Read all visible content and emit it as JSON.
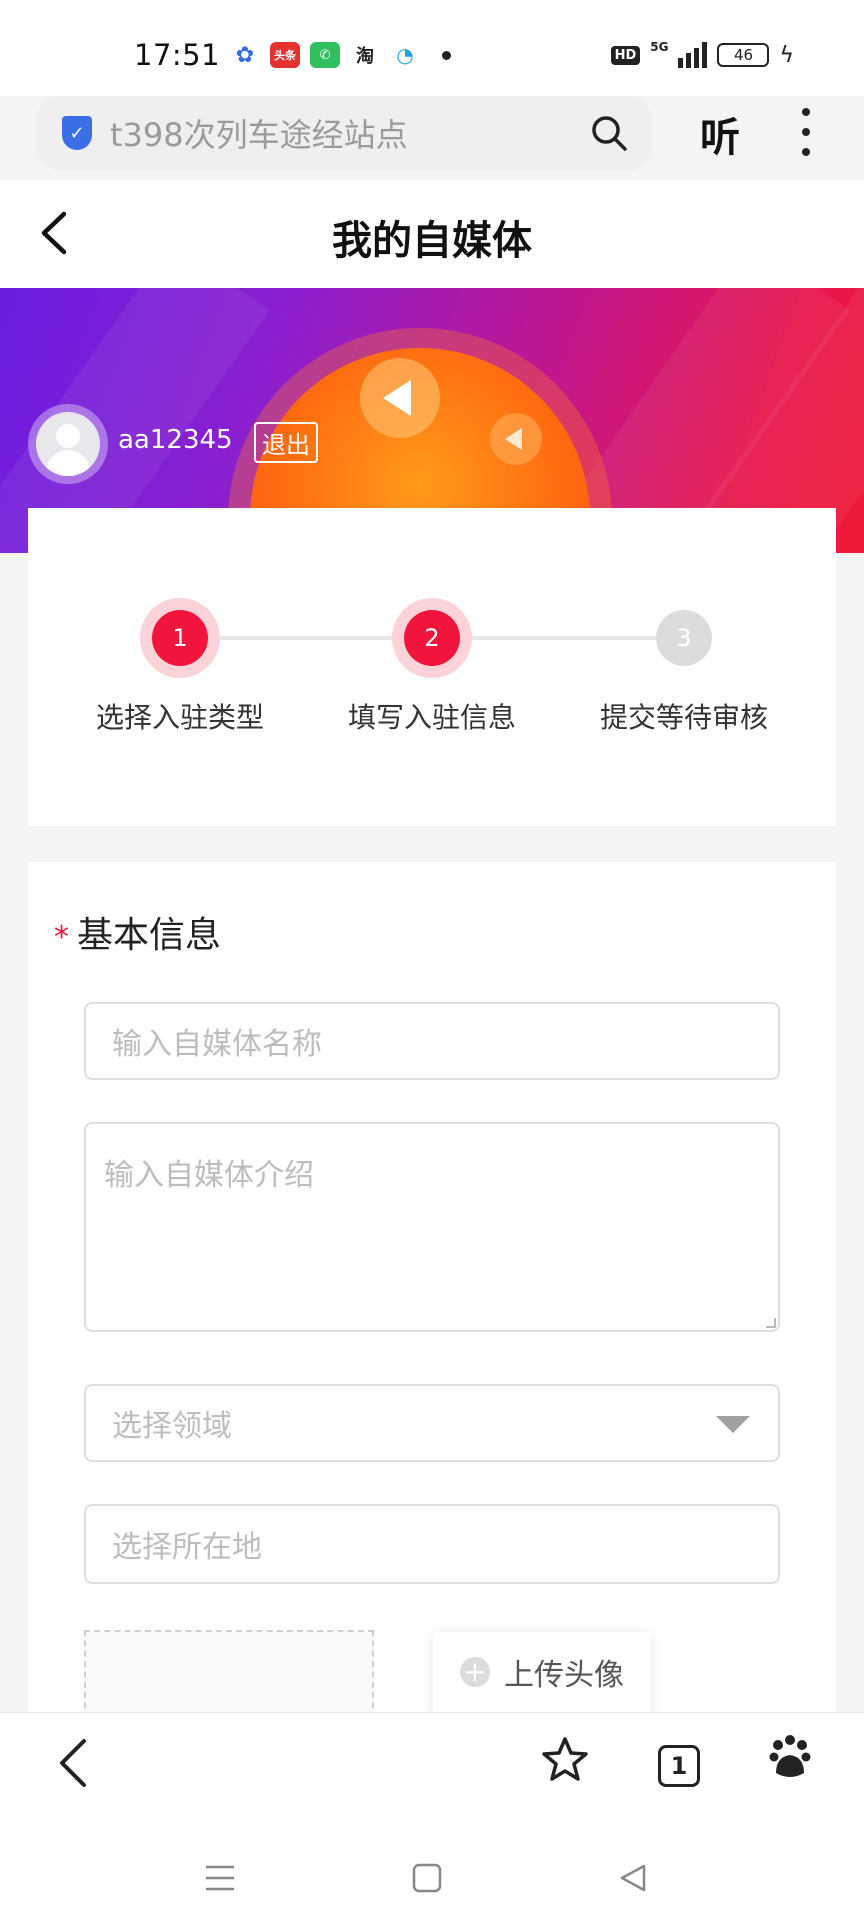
{
  "status_bar": {
    "time": "17:51",
    "apps": [
      "baidu",
      "toutiao",
      "phone",
      "taobao",
      "chat"
    ],
    "toutiao_label": "头条",
    "taobao_label": "淘",
    "hd": "HD",
    "network": "5G",
    "battery": "46"
  },
  "search": {
    "query": "t398次列车途经站点"
  },
  "header_right": {
    "listen_label": "听"
  },
  "page": {
    "title": "我的自媒体"
  },
  "user": {
    "name": "aa12345",
    "logout_label": "退出"
  },
  "steps": [
    {
      "number": "1",
      "label": "选择入驻类型",
      "state": "active"
    },
    {
      "number": "2",
      "label": "填写入驻信息",
      "state": "active"
    },
    {
      "number": "3",
      "label": "提交等待审核",
      "state": "inactive"
    }
  ],
  "form": {
    "section_title": "基本信息",
    "required_mark": "*",
    "name_placeholder": "输入自媒体名称",
    "intro_placeholder": "输入自媒体介绍",
    "field_placeholder": "选择领域",
    "location_placeholder": "选择所在地",
    "upload_label": "上传头像"
  },
  "bottom_bar": {
    "tab_count": "1"
  },
  "colors": {
    "accent": "#f1153d",
    "banner_start": "#6a1ee0",
    "banner_end": "#ee1a36",
    "step_inactive": "#dcdcdc"
  }
}
